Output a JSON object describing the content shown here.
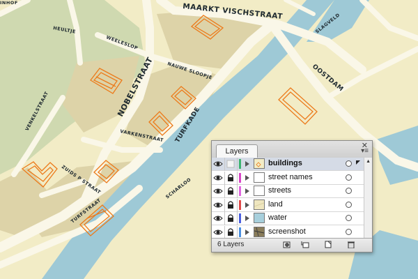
{
  "map": {
    "streets": [
      "MAARKT VISCHSTRAAT",
      "SLAGVELD",
      "HEULTJE",
      "WEELESLOP",
      "NAUWE SLOOPJE",
      "NOBELSTRAAT",
      "VENKELSTRAAT",
      "TURFKADE",
      "VARKENSTRAAT",
      "OOSTDAM",
      "ZUIDS P STRAAT",
      "TURFSTRAAT",
      "SCHARLOO",
      "INHOF"
    ]
  },
  "layers_panel": {
    "tab": "Layers",
    "close_symbol": "✕",
    "menu_symbol": "▾≡",
    "count_label": "6 Layers",
    "layers": [
      {
        "name": "buildings",
        "color": "#3cb371",
        "selected": true,
        "locked": false,
        "thumb": "buildings"
      },
      {
        "name": "street names",
        "color": "#d946c7",
        "selected": false,
        "locked": true,
        "thumb": "blank"
      },
      {
        "name": "streets",
        "color": "#e066e0",
        "selected": false,
        "locked": true,
        "thumb": "blank"
      },
      {
        "name": "land",
        "color": "#e04a4a",
        "selected": false,
        "locked": true,
        "thumb": "land"
      },
      {
        "name": "water",
        "color": "#4a5fe0",
        "selected": false,
        "locked": true,
        "thumb": "water"
      },
      {
        "name": "screenshot",
        "color": "#4a8fe0",
        "selected": false,
        "locked": true,
        "thumb": "screenshot"
      }
    ],
    "footer_buttons": [
      "make-clipping-mask",
      "create-sublayer",
      "create-new-layer",
      "delete-layer"
    ]
  }
}
